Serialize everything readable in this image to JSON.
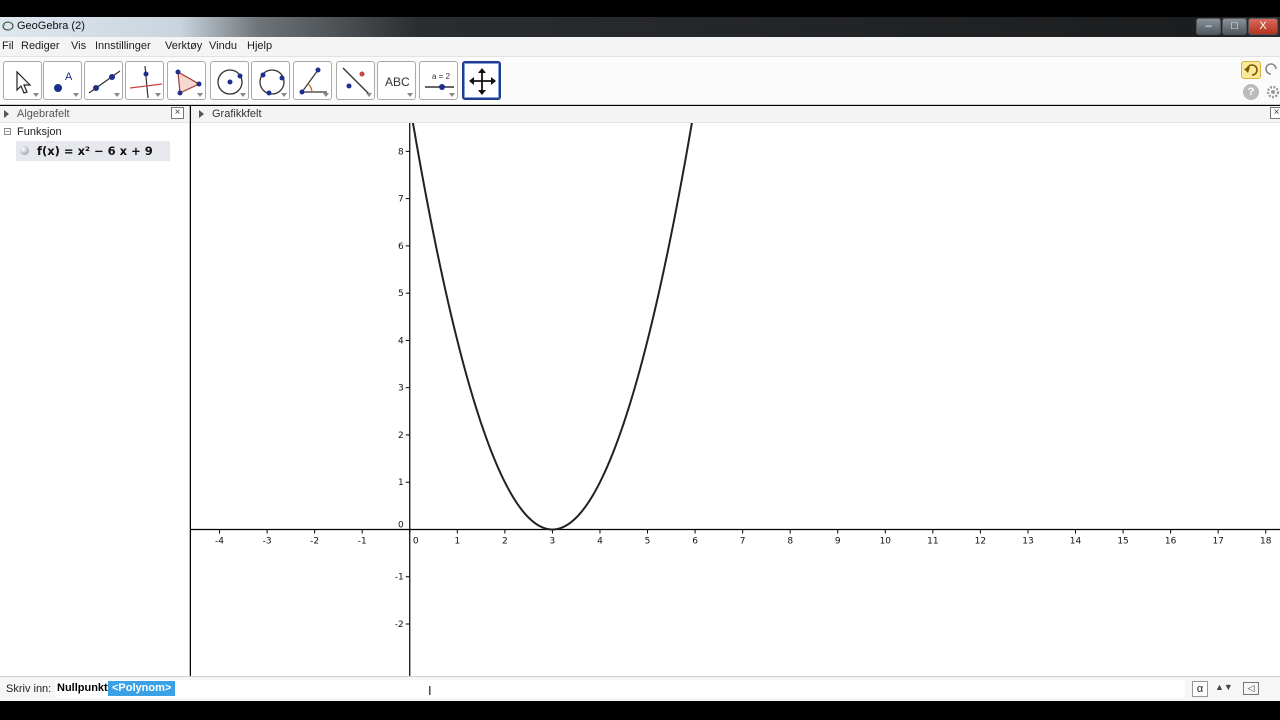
{
  "window": {
    "title": "GeoGebra (2)",
    "controls": [
      "–",
      "□",
      "X"
    ]
  },
  "menu": [
    "Fil",
    "Rediger",
    "Vis",
    "Innstillinger",
    "Verktøy",
    "Vindu",
    "Hjelp"
  ],
  "toolbar": {
    "text_tool_label": "ABC",
    "slider_tool_label": "a = 2",
    "tools": [
      "move-tool",
      "point-tool",
      "line-tool",
      "perpendicular-line-tool",
      "polygon-tool",
      "circle-tool",
      "circle-three-points-tool",
      "angle-tool",
      "reflect-tool",
      "text-tool",
      "slider-tool",
      "move-graphics-view-tool"
    ],
    "active_tool": "move-graphics-view-tool"
  },
  "algebra_view": {
    "title": "Algebrafelt",
    "group": "Funksjon",
    "objects": [
      {
        "label": "f(x) = x² − 6 x + 9"
      }
    ]
  },
  "graphics_view": {
    "title": "Grafikkfelt"
  },
  "chart_data": {
    "type": "line",
    "function": "f(x) = x² − 6x + 9",
    "xlim": [
      -4.6,
      18.3
    ],
    "ylim": [
      -3.1,
      8.6
    ],
    "x_ticks": [
      -4,
      -3,
      -2,
      -1,
      0,
      1,
      2,
      3,
      4,
      5,
      6,
      7,
      8,
      9,
      10,
      11,
      12,
      13,
      14,
      15,
      16,
      17,
      18
    ],
    "y_ticks": [
      -2,
      -1,
      0,
      1,
      2,
      3,
      4,
      5,
      6,
      7,
      8
    ],
    "series": [
      {
        "x": [
          0,
          0.5,
          1,
          1.5,
          2,
          2.5,
          3,
          3.5,
          4,
          4.5,
          5,
          5.5,
          6
        ],
        "y": [
          9,
          6.25,
          4,
          2.25,
          1,
          0.25,
          0,
          0.25,
          1,
          2.25,
          4,
          6.25,
          9
        ]
      }
    ],
    "colors": {
      "curve": "#222222",
      "axes": "#000000"
    },
    "grid": false
  },
  "input_bar": {
    "label": "Skriv inn:",
    "value": "Nullpunkt[",
    "suggestion": "<Polynom>",
    "alpha_button": "α"
  }
}
